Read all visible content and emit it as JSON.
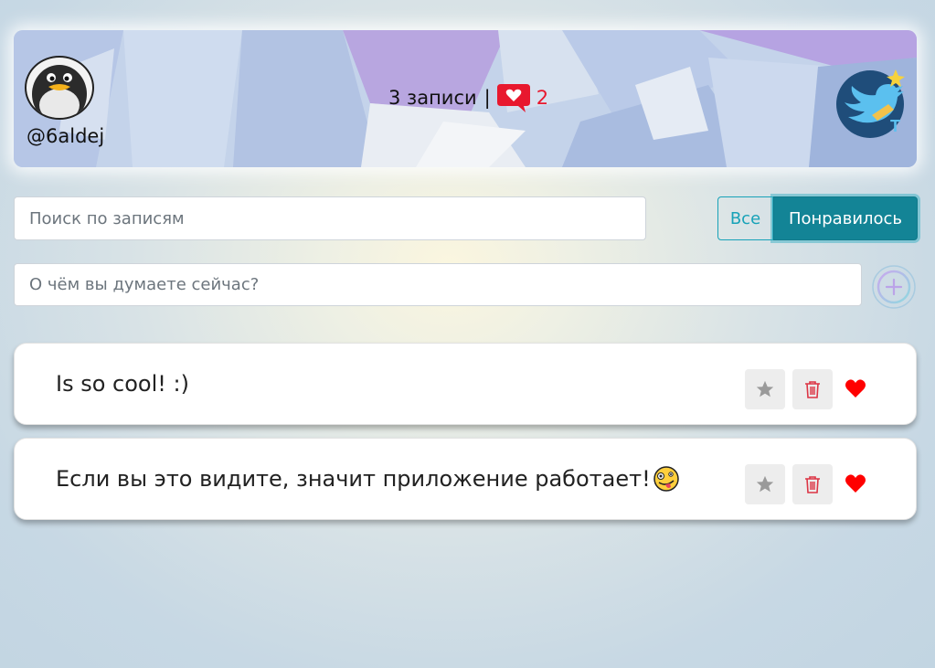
{
  "header": {
    "username": "@6aldej",
    "posts_count_label": "3 записи",
    "separator": "|",
    "likes_count": "2",
    "colors": {
      "likes": "#e8182e"
    },
    "avatar_icon": "penguin-icon",
    "logo_icon": "twitter-bird-icon"
  },
  "search": {
    "placeholder": "Поиск по записям"
  },
  "filter": {
    "all_label": "Все",
    "liked_label": "Понравилось",
    "active": "liked",
    "colors": {
      "accent": "#17a2b8",
      "active_bg": "#138496"
    }
  },
  "new_post": {
    "placeholder": "О чём вы думаете сейчас?",
    "add_icon": "plus-circle-icon"
  },
  "posts": [
    {
      "text": "Is so cool! :)",
      "liked": true
    },
    {
      "text": "Если вы это видите, значит приложение работает!",
      "emoji": "zany-face-emoji",
      "liked": true
    }
  ]
}
